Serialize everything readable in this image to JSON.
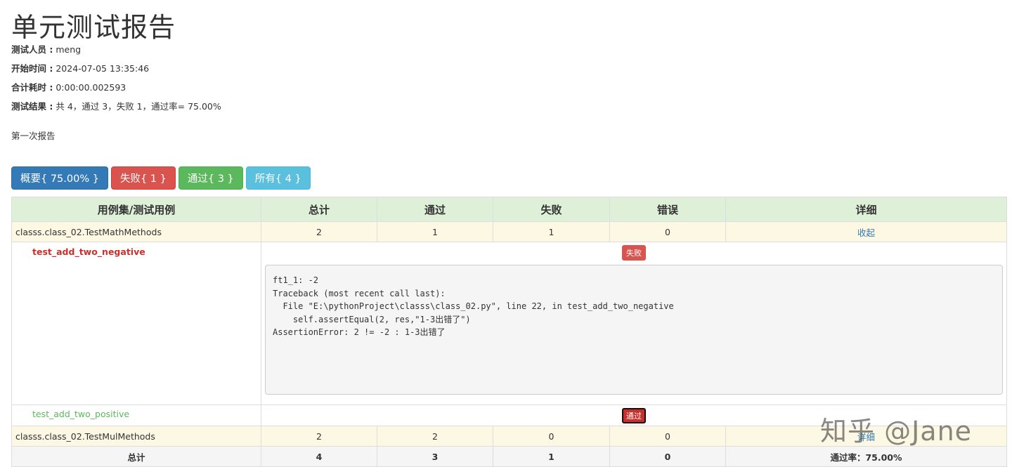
{
  "title": "单元测试报告",
  "meta": {
    "tester_label": "测试人员 :",
    "tester": "meng",
    "start_label": "开始时间 :",
    "start": "2024-07-05 13:35:46",
    "duration_label": "合计耗时 :",
    "duration": "0:00:00.002593",
    "result_label": "测试结果 :",
    "result": "共 4，通过 3，失败 1，通过率= 75.00%"
  },
  "description": "第一次报告",
  "filters": {
    "summary": "概要{ 75.00% }",
    "failed": "失败{ 1 }",
    "passed": "通过{ 3 }",
    "all": "所有{ 4 }"
  },
  "table": {
    "headers": [
      "用例集/测试用例",
      "总计",
      "通过",
      "失败",
      "错误",
      "详细"
    ],
    "suites": [
      {
        "name": "classs.class_02.TestMathMethods",
        "total": "2",
        "passed": "1",
        "failed": "1",
        "error": "0",
        "detail": "收起"
      },
      {
        "name": "classs.class_02.TestMulMethods",
        "total": "2",
        "passed": "2",
        "failed": "0",
        "error": "0",
        "detail": "详细"
      }
    ],
    "cases": [
      {
        "name": "test_add_two_negative",
        "status": "失败",
        "log": "ft1_1: -2\nTraceback (most recent call last):\n  File \"E:\\pythonProject\\classs\\class_02.py\", line 22, in test_add_two_negative\n    self.assertEqual(2, res,\"1-3出错了\")\nAssertionError: 2 != -2 : 1-3出错了"
      },
      {
        "name": "test_add_two_positive",
        "status": "通过"
      }
    ],
    "total": {
      "label": "总计",
      "total": "4",
      "passed": "3",
      "failed": "1",
      "error": "0",
      "rate": "通过率：75.00%"
    }
  },
  "watermark": "知乎 @Jane",
  "colors": {
    "primary": "#337ab7",
    "danger": "#d9534f",
    "success": "#5cb85c",
    "info": "#5bc0de",
    "header_bg": "#dff0d8",
    "suite_bg": "#fcf8e3"
  }
}
